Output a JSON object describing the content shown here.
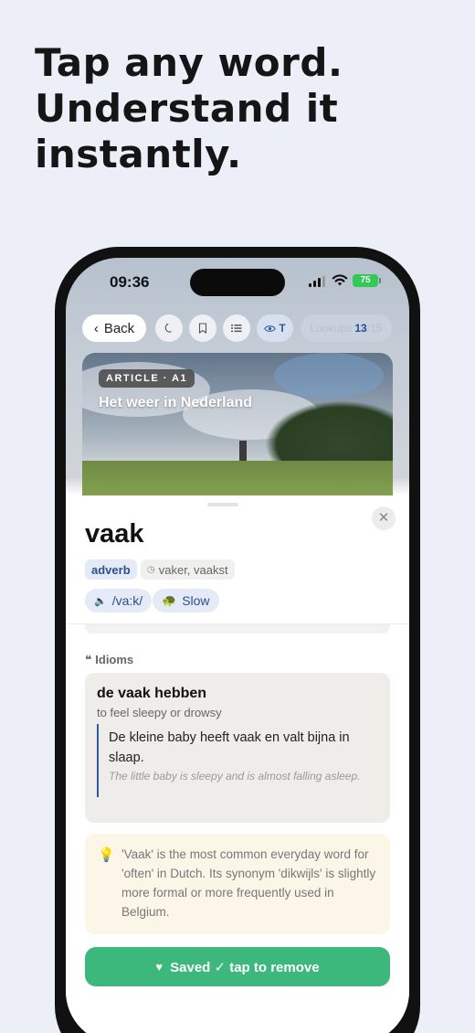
{
  "promo": {
    "headline_line1": "Tap any word.",
    "headline_line2": "Understand it",
    "headline_line3": "instantly."
  },
  "statusbar": {
    "time": "09:36",
    "battery": "75"
  },
  "toolbar": {
    "back_label": "Back",
    "icons": [
      "moon-icon",
      "bookmark-icon",
      "list-icon",
      "eye-icon"
    ],
    "eye_label": "T",
    "lookups_label": "Lookups",
    "lookups_count": "13",
    "lookups_total": "/15"
  },
  "article": {
    "tag": "ARTICLE · A1",
    "title": "Het weer in Nederland"
  },
  "entry": {
    "word": "vaak",
    "part_of_speech": "adverb",
    "forms": "vaker, vaakst",
    "pronunciation": "/va:k/",
    "slow_label": "Slow",
    "close_icon": "close-icon"
  },
  "idioms": {
    "section_label": "Idioms",
    "items": [
      {
        "phrase": "de vaak hebben",
        "definition": "to feel sleepy or drowsy",
        "example_nl": "De kleine baby heeft vaak en valt bijna in slaap.",
        "example_en": "The little baby is sleepy and is almost falling asleep."
      }
    ]
  },
  "tip": {
    "icon": "lightbulb-icon",
    "text": "'Vaak' is the most common everyday word for 'often' in Dutch. Its synonym 'dikwijls' is slightly more formal or more frequently used in Belgium."
  },
  "save": {
    "label": "Saved ✓ tap to remove"
  },
  "colors": {
    "background": "#eceff8",
    "accent_blue": "#2c4f8f",
    "saved_green": "#3db87c",
    "battery_green": "#34c759"
  }
}
